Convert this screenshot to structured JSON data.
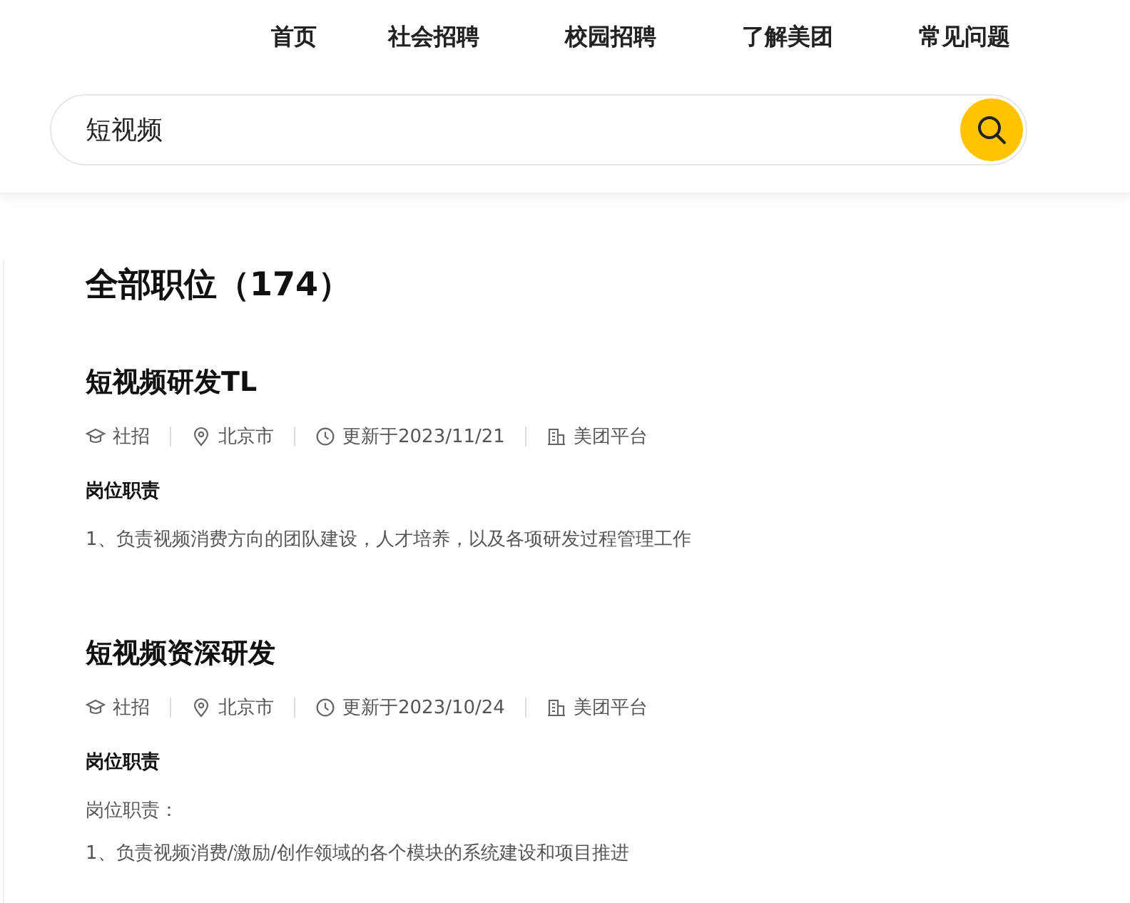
{
  "nav": [
    "首页",
    "社会招聘",
    "校园招聘",
    "了解美团",
    "常见问题"
  ],
  "search": {
    "value": "短视频"
  },
  "heading": "全部职位（174）",
  "jobs": [
    {
      "title": "短视频研发TL",
      "meta": [
        {
          "kind": "type",
          "text": "社招"
        },
        {
          "kind": "location",
          "text": "北京市"
        },
        {
          "kind": "updated",
          "text": "更新于2023/11/21"
        },
        {
          "kind": "department",
          "text": "美团平台"
        }
      ],
      "section": "岗位职责",
      "lines": [
        "1、负责视频消费方向的团队建设，人才培养，以及各项研发过程管理工作"
      ]
    },
    {
      "title": "短视频资深研发",
      "meta": [
        {
          "kind": "type",
          "text": "社招"
        },
        {
          "kind": "location",
          "text": "北京市"
        },
        {
          "kind": "updated",
          "text": "更新于2023/10/24"
        },
        {
          "kind": "department",
          "text": "美团平台"
        }
      ],
      "section": "岗位职责",
      "lines": [
        "岗位职责：",
        "1、负责视频消费/激励/创作领域的各个模块的系统建设和项目推进"
      ]
    }
  ]
}
